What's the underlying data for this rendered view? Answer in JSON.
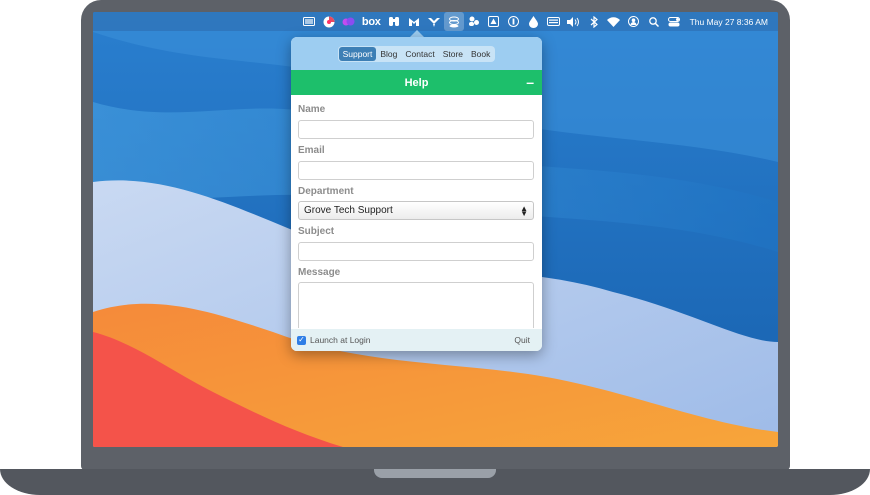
{
  "menubar": {
    "icons": [
      "display-icon",
      "pie-chart-icon",
      "cloud-icon",
      "box-icon",
      "binoculars-icon",
      "malwarebytes-icon",
      "bird-icon",
      "stack-icon",
      "people-icon",
      "drive-icon",
      "onepassword-icon",
      "drop-icon",
      "keyboard-icon",
      "volume-icon",
      "bluetooth-icon",
      "wifi-icon",
      "user-icon",
      "search-icon",
      "control-center-icon"
    ],
    "box_label": "box",
    "clock": "Thu May 27  8:36 AM"
  },
  "tabs": [
    {
      "label": "Support",
      "active": true
    },
    {
      "label": "Blog",
      "active": false
    },
    {
      "label": "Contact",
      "active": false
    },
    {
      "label": "Store",
      "active": false
    },
    {
      "label": "Book",
      "active": false
    }
  ],
  "help": {
    "title": "Help",
    "minimize": "–"
  },
  "form": {
    "name_label": "Name",
    "name_value": "",
    "email_label": "Email",
    "email_value": "",
    "department_label": "Department",
    "department_value": "Grove Tech Support",
    "subject_label": "Subject",
    "subject_value": "",
    "message_label": "Message",
    "message_value": ""
  },
  "footer": {
    "launch_label": "Launch at Login",
    "launch_checked": true,
    "quit_label": "Quit"
  },
  "colors": {
    "tab_bar": "#9dcdf1",
    "help_bar": "#1dbf6b",
    "footer": "#e4f1f4",
    "laptop": "#5d6168"
  }
}
